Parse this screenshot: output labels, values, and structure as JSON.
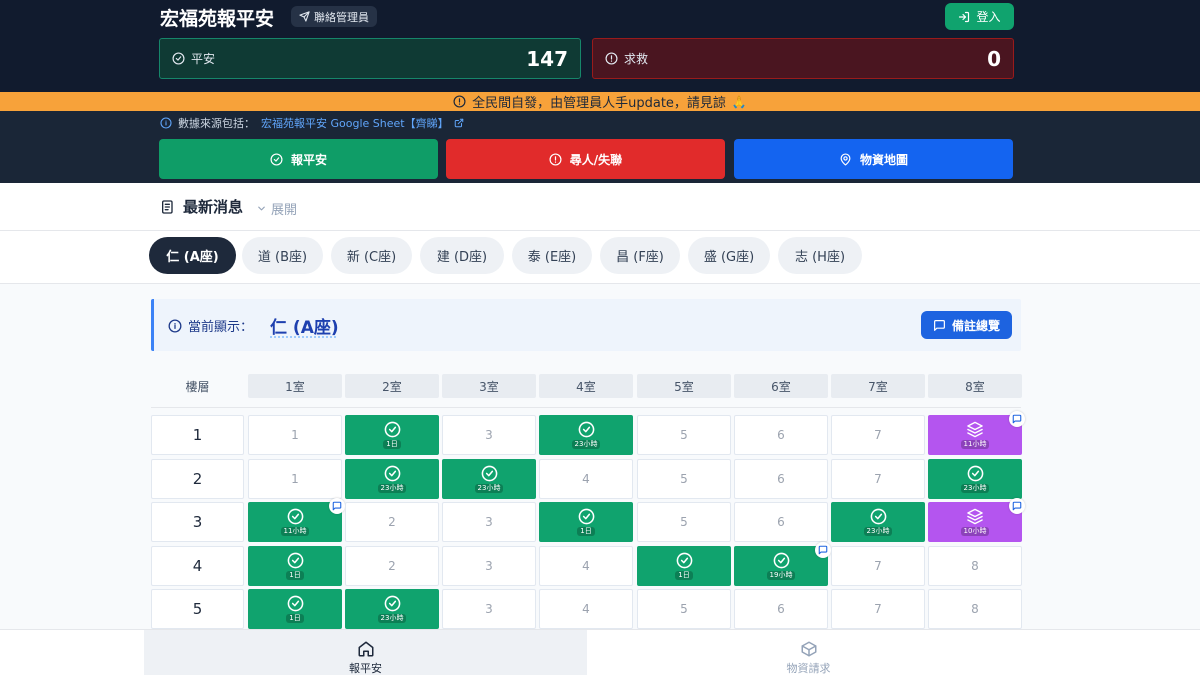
{
  "header": {
    "title": "宏福苑報平安",
    "contact_label": "聯絡管理員",
    "login_label": "登入",
    "stats": {
      "safe_label": "平安",
      "safe_count": "147",
      "help_label": "求救",
      "help_count": "0"
    }
  },
  "banner": {
    "text": "全民間自發，由管理員人手update，請見諒"
  },
  "source": {
    "prefix": "數據來源包括：",
    "link_text": "宏福苑報平安 Google Sheet【齊睇】"
  },
  "nav_buttons": {
    "report_safe": "報平安",
    "missing": "尋人/失聯",
    "supplies_map": "物資地圖"
  },
  "news": {
    "title": "最新消息",
    "expand_label": "展開"
  },
  "tabs": [
    "仁 (A座)",
    "道 (B座)",
    "新 (C座)",
    "建 (D座)",
    "泰 (E座)",
    "昌 (F座)",
    "盛 (G座)",
    "志 (H座)"
  ],
  "current": {
    "label": "當前顯示：",
    "value": "仁 (A座)",
    "notes_button": "備註總覽"
  },
  "grid": {
    "floor_header": "樓層",
    "rooms": [
      "1室",
      "2室",
      "3室",
      "4室",
      "5室",
      "6室",
      "7室",
      "8室"
    ],
    "rows": [
      {
        "floor": "1",
        "cells": [
          {
            "type": "empty",
            "text": "1"
          },
          {
            "type": "safe",
            "time": "1日"
          },
          {
            "type": "empty",
            "text": "3"
          },
          {
            "type": "safe",
            "time": "23小時"
          },
          {
            "type": "empty",
            "text": "5"
          },
          {
            "type": "empty",
            "text": "6"
          },
          {
            "type": "empty",
            "text": "7"
          },
          {
            "type": "stack",
            "time": "11小時",
            "note": true
          }
        ]
      },
      {
        "floor": "2",
        "cells": [
          {
            "type": "empty",
            "text": "1"
          },
          {
            "type": "safe",
            "time": "23小時"
          },
          {
            "type": "safe",
            "time": "23小時"
          },
          {
            "type": "empty",
            "text": "4"
          },
          {
            "type": "empty",
            "text": "5"
          },
          {
            "type": "empty",
            "text": "6"
          },
          {
            "type": "empty",
            "text": "7"
          },
          {
            "type": "safe",
            "time": "23小時"
          }
        ]
      },
      {
        "floor": "3",
        "cells": [
          {
            "type": "safe",
            "time": "11小時",
            "note": true
          },
          {
            "type": "empty",
            "text": "2"
          },
          {
            "type": "empty",
            "text": "3"
          },
          {
            "type": "safe",
            "time": "1日"
          },
          {
            "type": "empty",
            "text": "5"
          },
          {
            "type": "empty",
            "text": "6"
          },
          {
            "type": "safe",
            "time": "23小時"
          },
          {
            "type": "stack",
            "time": "10小時",
            "note": true
          }
        ]
      },
      {
        "floor": "4",
        "cells": [
          {
            "type": "safe",
            "time": "1日"
          },
          {
            "type": "empty",
            "text": "2"
          },
          {
            "type": "empty",
            "text": "3"
          },
          {
            "type": "empty",
            "text": "4"
          },
          {
            "type": "safe",
            "time": "1日"
          },
          {
            "type": "safe",
            "time": "19小時",
            "note": true
          },
          {
            "type": "empty",
            "text": "7"
          },
          {
            "type": "empty",
            "text": "8"
          }
        ]
      },
      {
        "floor": "5",
        "cells": [
          {
            "type": "safe",
            "time": "1日"
          },
          {
            "type": "safe",
            "time": "23小時"
          },
          {
            "type": "empty",
            "text": "3"
          },
          {
            "type": "empty",
            "text": "4"
          },
          {
            "type": "empty",
            "text": "5"
          },
          {
            "type": "empty",
            "text": "6"
          },
          {
            "type": "empty",
            "text": "7"
          },
          {
            "type": "empty",
            "text": "8"
          }
        ]
      }
    ]
  },
  "bottom_nav": {
    "home_label": "報平安",
    "supplies_label": "物資請求"
  },
  "colors": {
    "header_bg": "#111b2e",
    "safe_green": "#10a36e",
    "help_red": "#e12b2b",
    "map_blue": "#1464f0",
    "stack_purple": "#b455ef",
    "banner_orange": "#f7a23a"
  }
}
